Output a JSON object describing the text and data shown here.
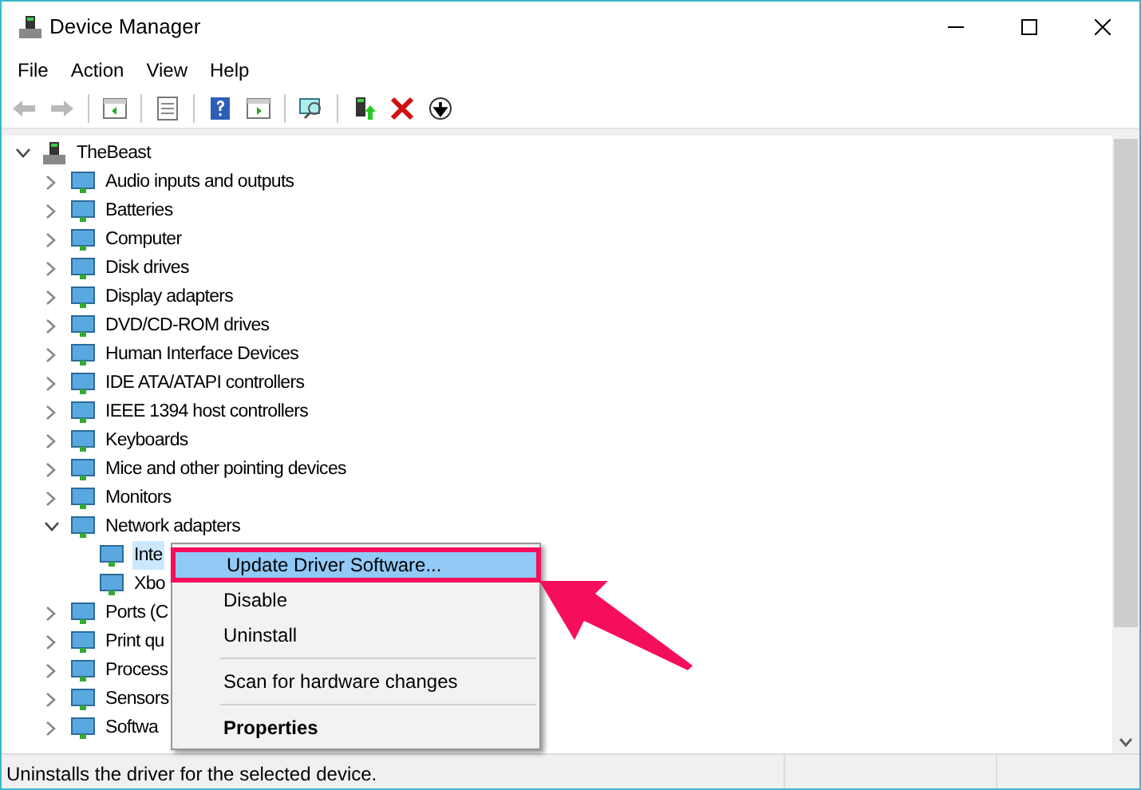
{
  "window": {
    "title": "Device Manager"
  },
  "menu_bar": [
    "File",
    "Action",
    "View",
    "Help"
  ],
  "toolbar": [
    {
      "kind": "back",
      "disabled": true
    },
    {
      "kind": "forward",
      "disabled": true
    },
    {
      "kind": "sep"
    },
    {
      "kind": "tree",
      "disabled": false
    },
    {
      "kind": "sep"
    },
    {
      "kind": "properties",
      "disabled": false
    },
    {
      "kind": "sep"
    },
    {
      "kind": "help",
      "disabled": false
    },
    {
      "kind": "pane",
      "disabled": false
    },
    {
      "kind": "sep"
    },
    {
      "kind": "scan",
      "disabled": false
    },
    {
      "kind": "sep"
    },
    {
      "kind": "update",
      "disabled": false
    },
    {
      "kind": "uninstall",
      "disabled": false
    },
    {
      "kind": "disable",
      "disabled": false
    }
  ],
  "tree": [
    {
      "label": "TheBeast",
      "expanded": true,
      "selected": false,
      "children": [
        {
          "label": "Audio inputs and outputs",
          "expanded": false,
          "selected": false
        },
        {
          "label": "Batteries",
          "expanded": false,
          "selected": false
        },
        {
          "label": "Computer",
          "expanded": false,
          "selected": false
        },
        {
          "label": "Disk drives",
          "expanded": false,
          "selected": false
        },
        {
          "label": "Display adapters",
          "expanded": false,
          "selected": false
        },
        {
          "label": "DVD/CD-ROM drives",
          "expanded": false,
          "selected": false
        },
        {
          "label": "Human Interface Devices",
          "expanded": false,
          "selected": false
        },
        {
          "label": "IDE ATA/ATAPI controllers",
          "expanded": false,
          "selected": false
        },
        {
          "label": "IEEE 1394 host controllers",
          "expanded": false,
          "selected": false
        },
        {
          "label": "Keyboards",
          "expanded": false,
          "selected": false
        },
        {
          "label": "Mice and other pointing devices",
          "expanded": false,
          "selected": false
        },
        {
          "label": "Monitors",
          "expanded": false,
          "selected": false
        },
        {
          "label": "Network adapters",
          "expanded": true,
          "selected": false,
          "children": [
            {
              "label": "Inte",
              "selected": true
            },
            {
              "label": "Xbo",
              "selected": false
            }
          ]
        },
        {
          "label": "Ports (C",
          "expanded": false,
          "selected": false
        },
        {
          "label": "Print qu",
          "expanded": false,
          "selected": false
        },
        {
          "label": "Process",
          "expanded": false,
          "selected": false
        },
        {
          "label": "Sensors",
          "expanded": false,
          "selected": false
        },
        {
          "label": "Softwa",
          "expanded": false,
          "selected": false
        }
      ]
    }
  ],
  "context_menu": [
    {
      "kind": "item",
      "label": "Update Driver Software...",
      "selected": true,
      "default": false
    },
    {
      "kind": "item",
      "label": "Disable",
      "selected": false,
      "default": false
    },
    {
      "kind": "item",
      "label": "Uninstall",
      "selected": false,
      "default": false
    },
    {
      "kind": "separator"
    },
    {
      "kind": "item",
      "label": "Scan for hardware changes",
      "selected": false,
      "default": false
    },
    {
      "kind": "separator"
    },
    {
      "kind": "item",
      "label": "Properties",
      "selected": false,
      "default": true
    }
  ],
  "status_bar": {
    "text": "Uninstalls the driver for the selected device."
  }
}
